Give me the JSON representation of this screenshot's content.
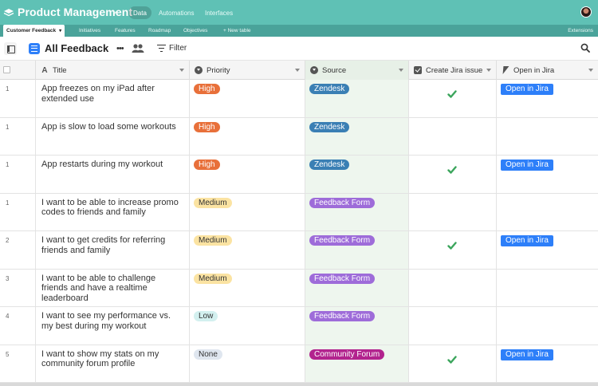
{
  "app": {
    "title": "Product Management",
    "nav": [
      "Data",
      "Automations",
      "Interfaces"
    ],
    "active_nav": "Data"
  },
  "tables": {
    "tabs": [
      "Customer Feedback",
      "Initiatives",
      "Features",
      "Roadmap",
      "Objectives",
      "+ New table"
    ],
    "active_tab": "Customer Feedback",
    "extensions_label": "Extensions"
  },
  "view": {
    "name": "All Feedback",
    "filter_label": "Filter"
  },
  "columns": {
    "title": "Title",
    "priority": "Priority",
    "source": "Source",
    "create_jira": "Create Jira issue",
    "open_jira": "Open in Jira"
  },
  "colors": {
    "appbar": "#5fc1b5",
    "tabsbar": "#4aa39a",
    "high": "#e8703a",
    "medium": "#fbe3a2",
    "low": "#d3f0ef",
    "none": "#dfe6ef",
    "zendesk": "#3a7fb4",
    "feedback_form": "#9e6cd9",
    "community_forum": "#b2238e",
    "jira_button": "#2d7ff9",
    "check": "#3ba55c"
  },
  "rows": [
    {
      "num": "1",
      "title": "App freezes on my iPad after extended use",
      "priority": "High",
      "source": "Zendesk",
      "create_jira": true,
      "open_jira": "Open in Jira"
    },
    {
      "num": "1",
      "title": "App is slow to load some workouts",
      "priority": "High",
      "source": "Zendesk",
      "create_jira": false,
      "open_jira": ""
    },
    {
      "num": "1",
      "title": "App restarts during my workout",
      "priority": "High",
      "source": "Zendesk",
      "create_jira": true,
      "open_jira": "Open in Jira"
    },
    {
      "num": "1",
      "title": "I want to be able to increase promo codes to friends and family",
      "priority": "Medium",
      "source": "Feedback Form",
      "create_jira": false,
      "open_jira": ""
    },
    {
      "num": "2",
      "title": "I want to get credits for referring friends and family",
      "priority": "Medium",
      "source": "Feedback Form",
      "create_jira": true,
      "open_jira": "Open in Jira"
    },
    {
      "num": "3",
      "title": "I want to be able to challenge friends and have a realtime leaderboard",
      "priority": "Medium",
      "source": "Feedback Form",
      "create_jira": false,
      "open_jira": ""
    },
    {
      "num": "4",
      "title": "I want to see my performance vs. my best during my workout",
      "priority": "Low",
      "source": "Feedback Form",
      "create_jira": false,
      "open_jira": ""
    },
    {
      "num": "5",
      "title": "I want to show my stats on my community forum profile",
      "priority": "None",
      "source": "Community Forum",
      "create_jira": true,
      "open_jira": "Open in Jira"
    }
  ]
}
